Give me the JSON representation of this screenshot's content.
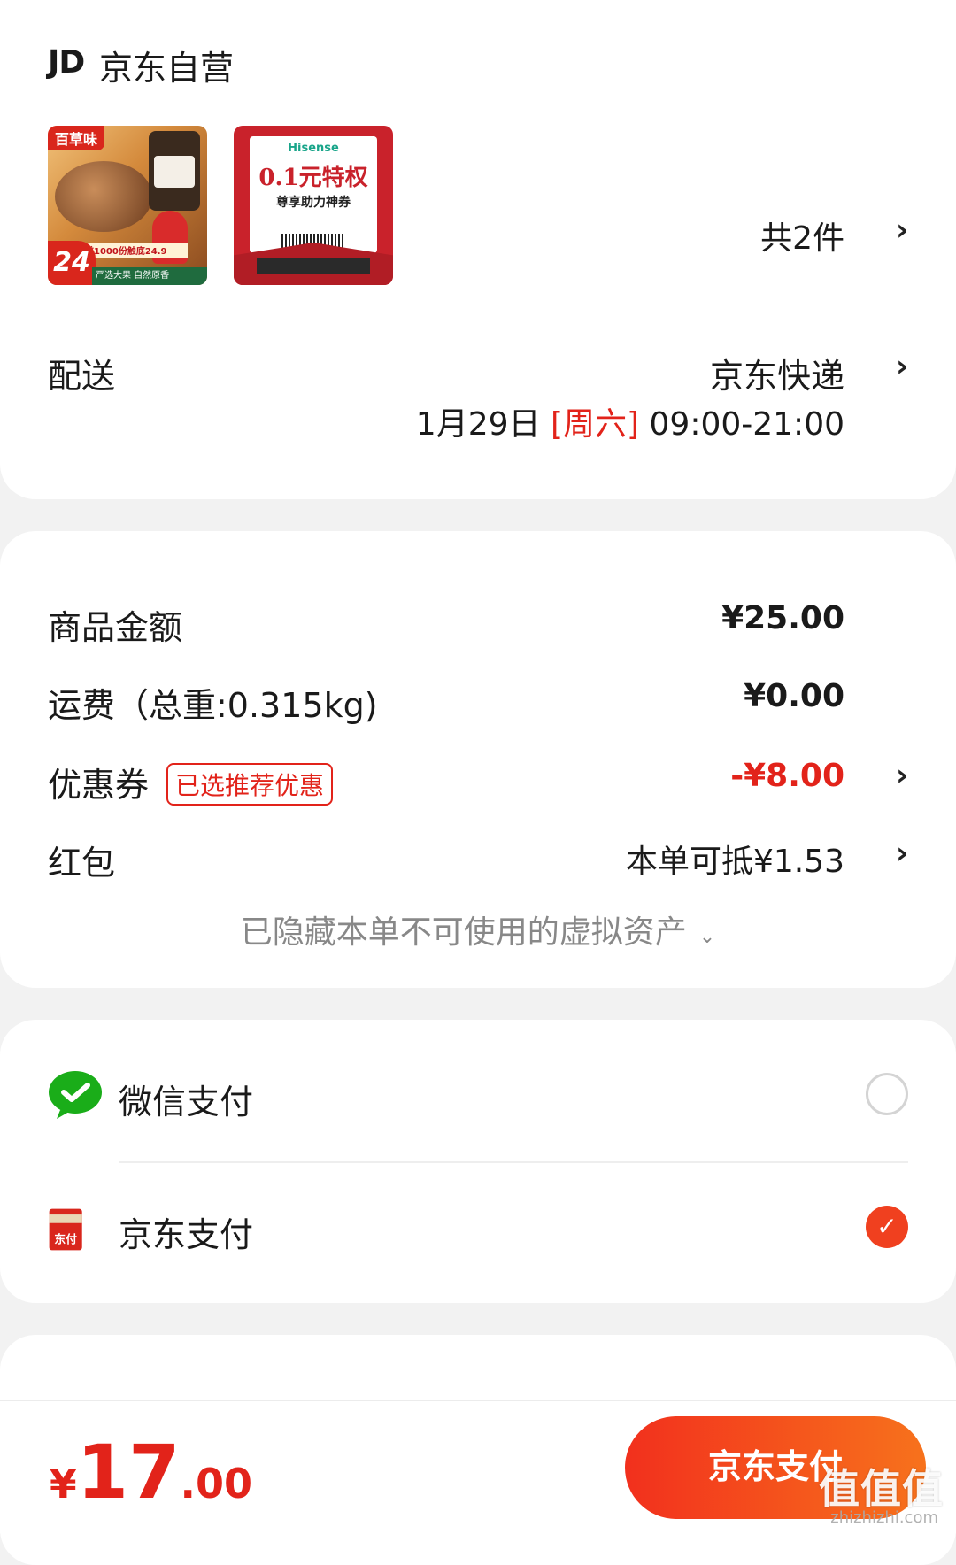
{
  "shop": {
    "logo": "JD",
    "name": "京东自营"
  },
  "thumbs": {
    "item1": {
      "brand": "百草味",
      "promo": "前1000份触底24.9",
      "price": "24",
      "band": "严选大果 自然原香"
    },
    "item2": {
      "brand": "Hisense",
      "headline": "0.1元特权",
      "sub": "尊享助力神券"
    }
  },
  "items_count": "共2件",
  "delivery": {
    "label": "配送",
    "method": "京东快递",
    "date": "1月29日",
    "weekday": "[周六]",
    "time": "09:00-21:00"
  },
  "summary": {
    "goods_label": "商品金额",
    "goods_value": "¥25.00",
    "shipping_label": "运费（总重:0.315kg)",
    "shipping_value": "¥0.00",
    "coupon_label": "优惠券",
    "coupon_tag": "已选推荐优惠",
    "coupon_value": "-¥8.00",
    "redpacket_label": "红包",
    "redpacket_value": "本单可抵¥1.53",
    "hidden_assets": "已隐藏本单不可使用的虚拟资产"
  },
  "payment": {
    "methods": [
      {
        "label": "微信支付",
        "selected": false
      },
      {
        "label": "京东支付",
        "selected": true
      }
    ],
    "jd_icon_text": "东付"
  },
  "footer": {
    "currency": "¥",
    "total_int": "17",
    "total_dec": ".00",
    "pay_button": "京东支付",
    "watermark": "值值值",
    "watermark_sub": "zhizhizhi.com"
  },
  "colors": {
    "accent": "#e2231a",
    "button_start": "#f2301d",
    "button_end": "#f7721c",
    "wechat_green": "#1aad19"
  },
  "icons": {
    "chevron": "chevron-right-icon",
    "expand": "chevron-down-icon",
    "check": "check-icon"
  }
}
